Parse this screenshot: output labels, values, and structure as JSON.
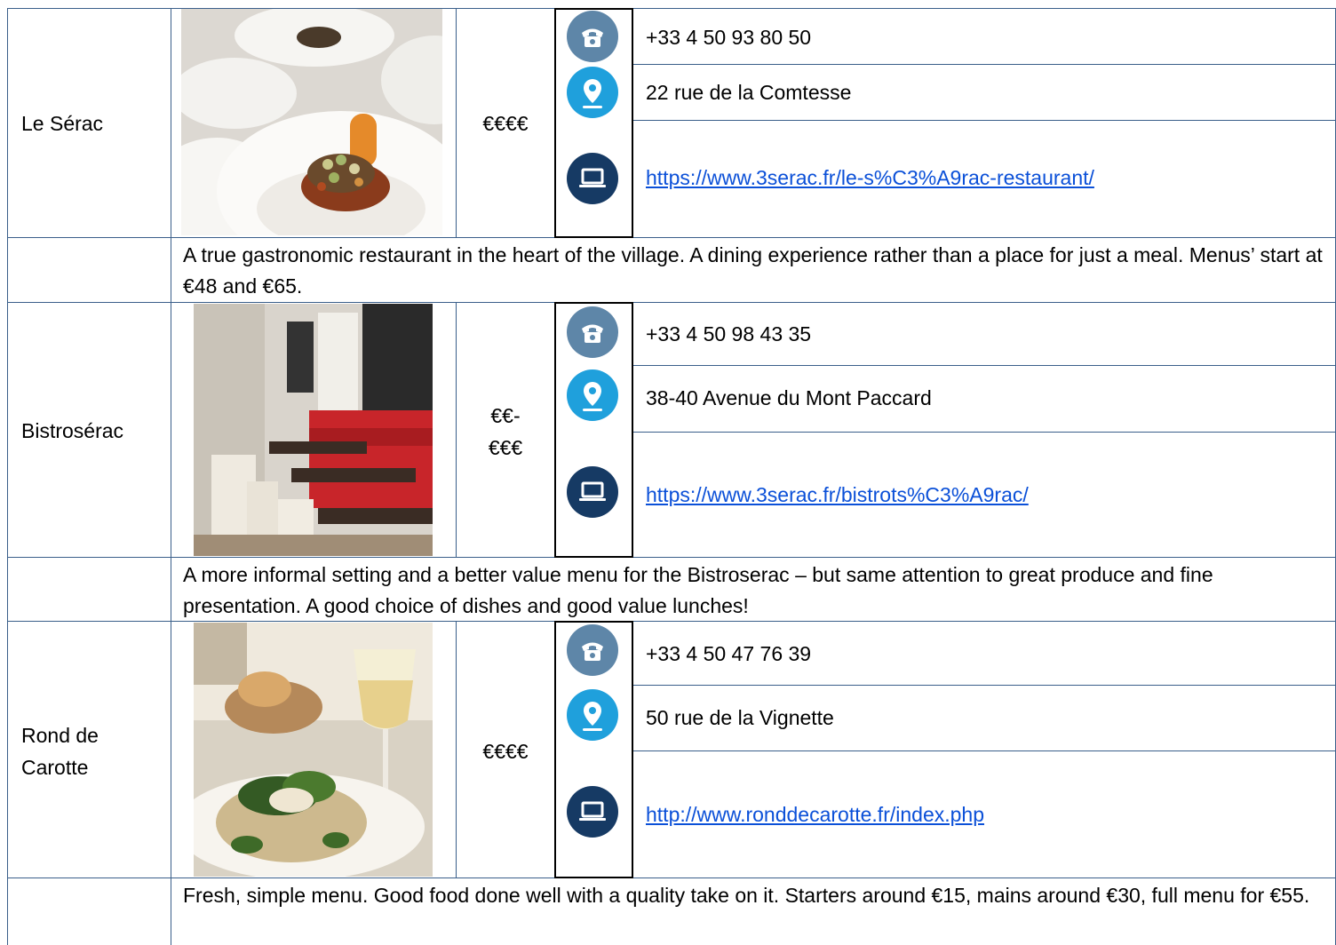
{
  "restaurants": [
    {
      "name": "Le Sérac",
      "price": "€€€€",
      "phone": "+33 4 50 93 80 50",
      "address": "22 rue de la Comtesse",
      "website": "https://www.3serac.fr/le-s%C3%A9rac-restaurant/",
      "description": "A true gastronomic restaurant in the heart of the village. A dining experience rather than a place for just a meal. Menus’ start at €48 and €65."
    },
    {
      "name": "Bistrosérac",
      "price_line1": "€€-",
      "price_line2": "€€€",
      "phone": "+33 4 50 98 43 35",
      "address": "38-40 Avenue du Mont Paccard",
      "website": "https://www.3serac.fr/bistrots%C3%A9rac/",
      "description": "A more informal setting and a better value menu for the Bistroserac – but same attention to great produce and fine presentation. A good choice of dishes and good value lunches!"
    },
    {
      "name_line1": "Rond de",
      "name_line2": "Carotte",
      "price": "€€€€",
      "phone": "+33 4 50 47 76 39",
      "address": "50 rue de la Vignette",
      "website": "http://www.ronddecarotte.fr/index.php",
      "description": "Fresh, simple menu. Good food done well with a quality take on it. Starters around €15, mains around €30, full menu for €55."
    }
  ],
  "icons": {
    "phone": "phone-icon",
    "location": "location-pin-icon",
    "web": "laptop-icon"
  },
  "colors": {
    "phone_icon": "#5e86a8",
    "location_icon": "#1fa0dc",
    "web_icon": "#163a64",
    "link": "#0b50d8",
    "grid": "#3a5f8a"
  }
}
